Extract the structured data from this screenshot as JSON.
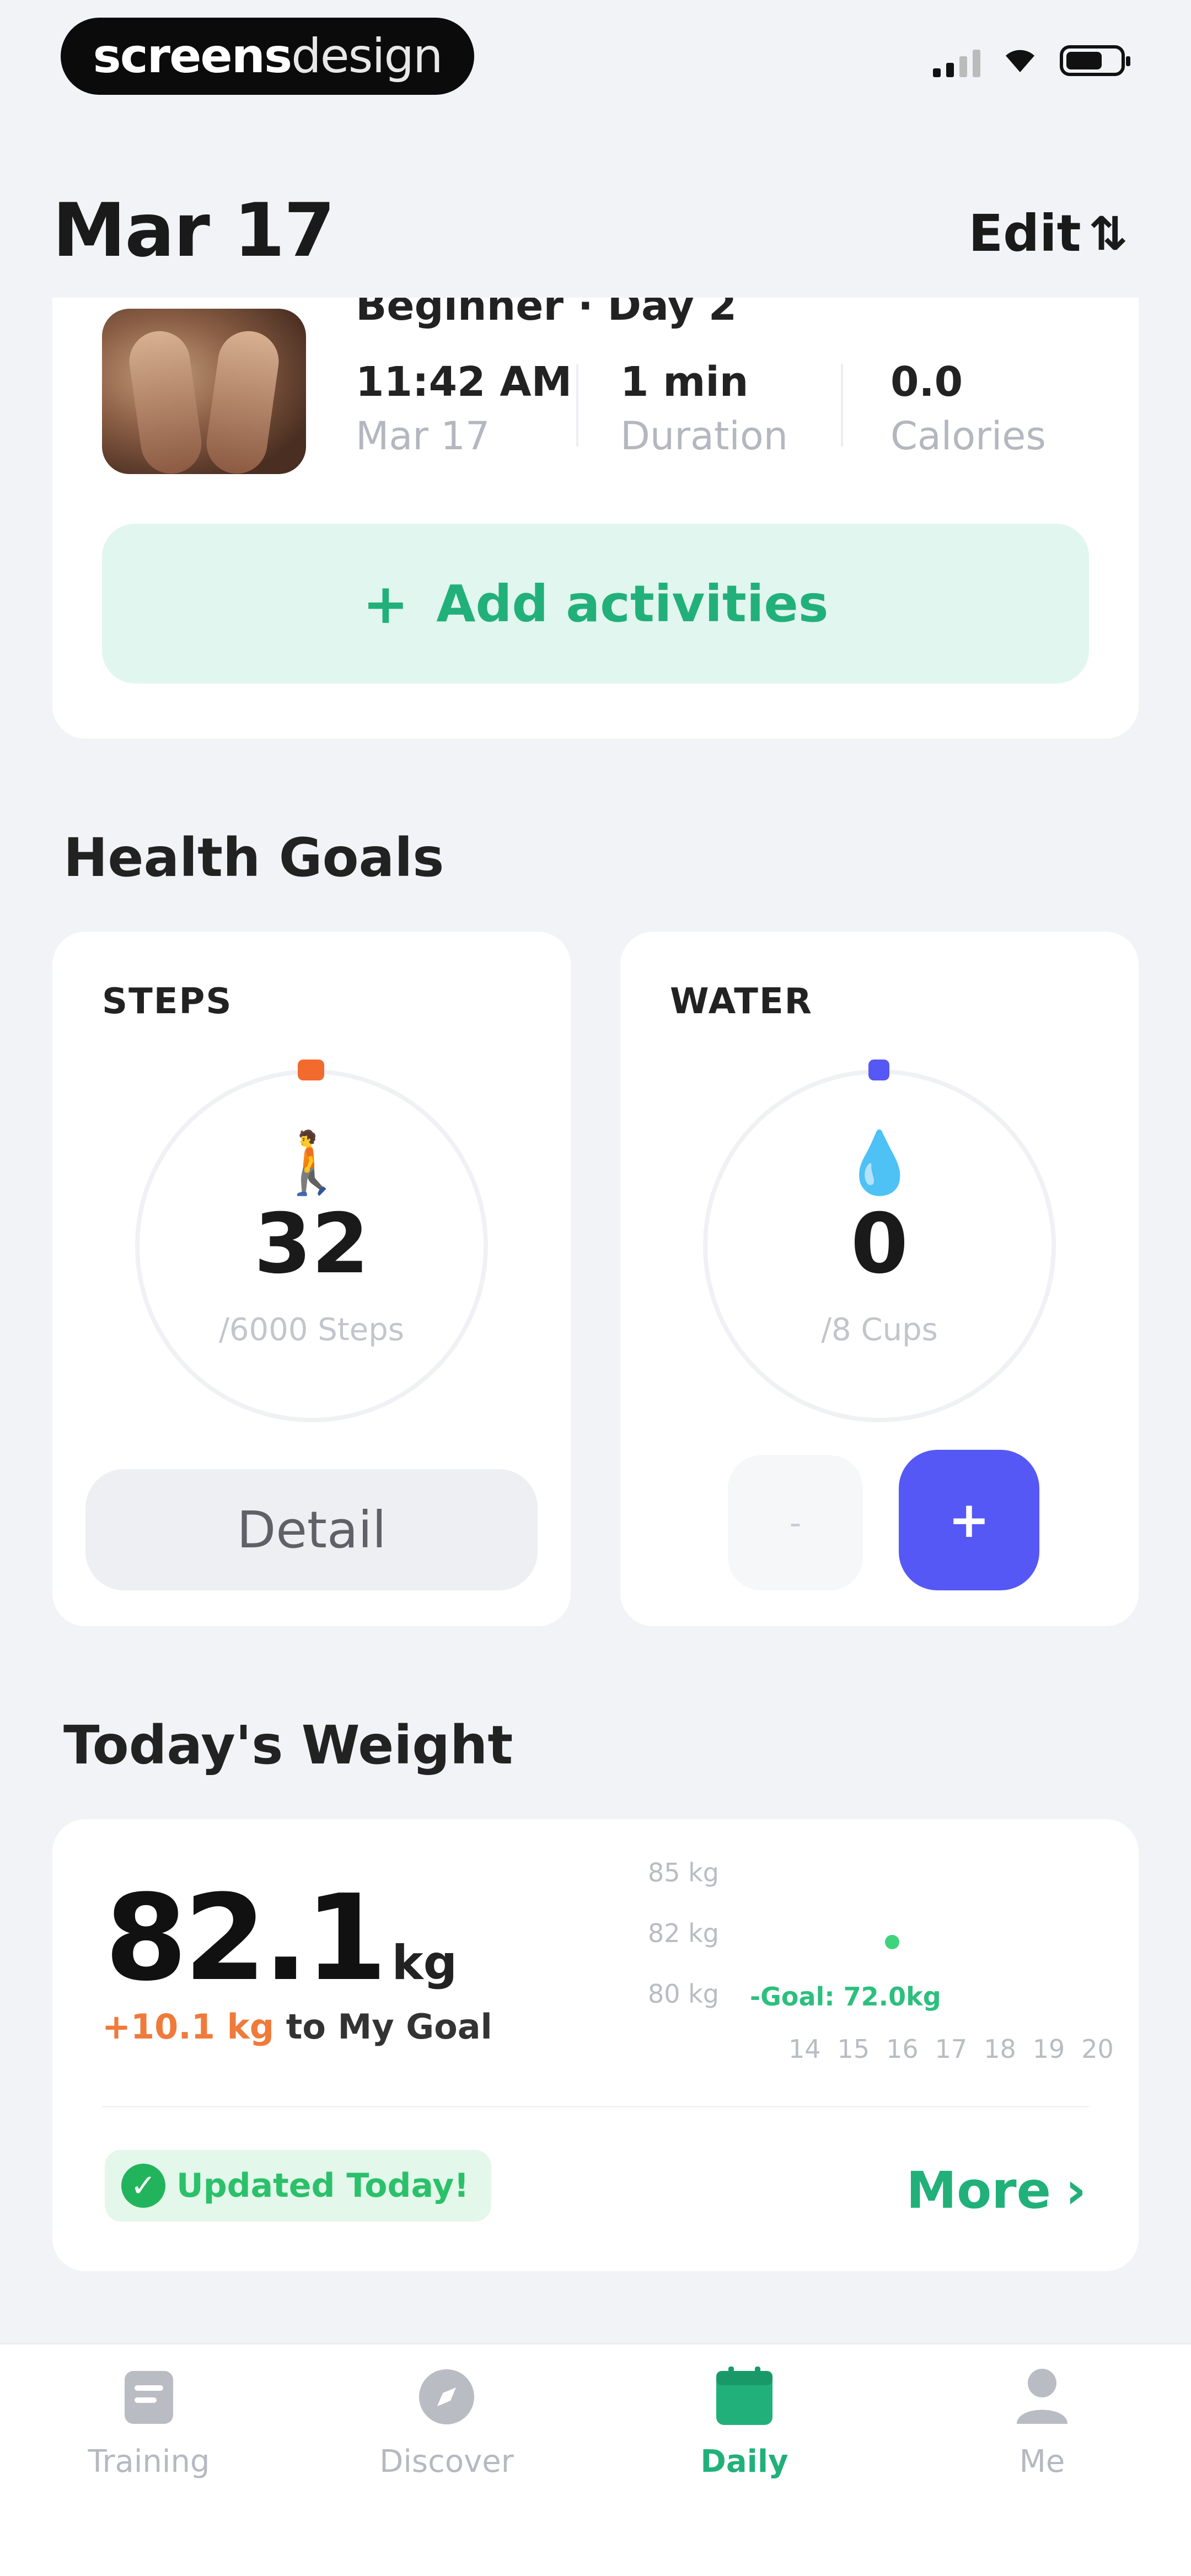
{
  "status_bar": {
    "brand_bold": "screens",
    "brand_light": "design"
  },
  "header": {
    "date": "Mar 17",
    "edit_label": "Edit",
    "edit_icon": "sort-icon"
  },
  "activity": {
    "title_partial": "Beginner · Day 2",
    "time": "11:42 AM",
    "date": "Mar 17",
    "duration_value": "1 min",
    "duration_label": "Duration",
    "calories_value": "0.0",
    "calories_label": "Calories",
    "add_label": "Add activities"
  },
  "health_goals": {
    "title": "Health Goals",
    "steps": {
      "label": "STEPS",
      "value": "32",
      "sub": "/6000 Steps",
      "detail_label": "Detail",
      "accent": "#f26a2e",
      "icon": "walking-person-icon"
    },
    "water": {
      "label": "WATER",
      "value": "0",
      "sub": "/8 Cups",
      "minus_label": "-",
      "plus_label": "+",
      "accent": "#5558f5",
      "icon": "water-drop-icon"
    }
  },
  "weight": {
    "title": "Today's Weight",
    "value": "82.1",
    "unit": "kg",
    "diff": "+10.1 kg",
    "diff_suffix": "to My Goal",
    "chart": {
      "y_labels": [
        "85 kg",
        "82 kg",
        "80 kg"
      ],
      "goal_label": "-Goal: 72.0kg",
      "x_labels": [
        "14",
        "15",
        "16",
        "17",
        "18",
        "19",
        "20"
      ]
    },
    "updated_label": "Updated Today!",
    "more_label": "More"
  },
  "tabs": [
    {
      "label": "Training",
      "icon": "clipboard-icon",
      "active": false
    },
    {
      "label": "Discover",
      "icon": "compass-icon",
      "active": false
    },
    {
      "label": "Daily",
      "icon": "calendar-icon",
      "active": true
    },
    {
      "label": "Me",
      "icon": "person-icon",
      "active": false
    }
  ],
  "colors": {
    "brand_green": "#22b07a",
    "water_blue": "#5558f5",
    "steps_orange": "#f26a2e",
    "background": "#f2f3f7"
  }
}
